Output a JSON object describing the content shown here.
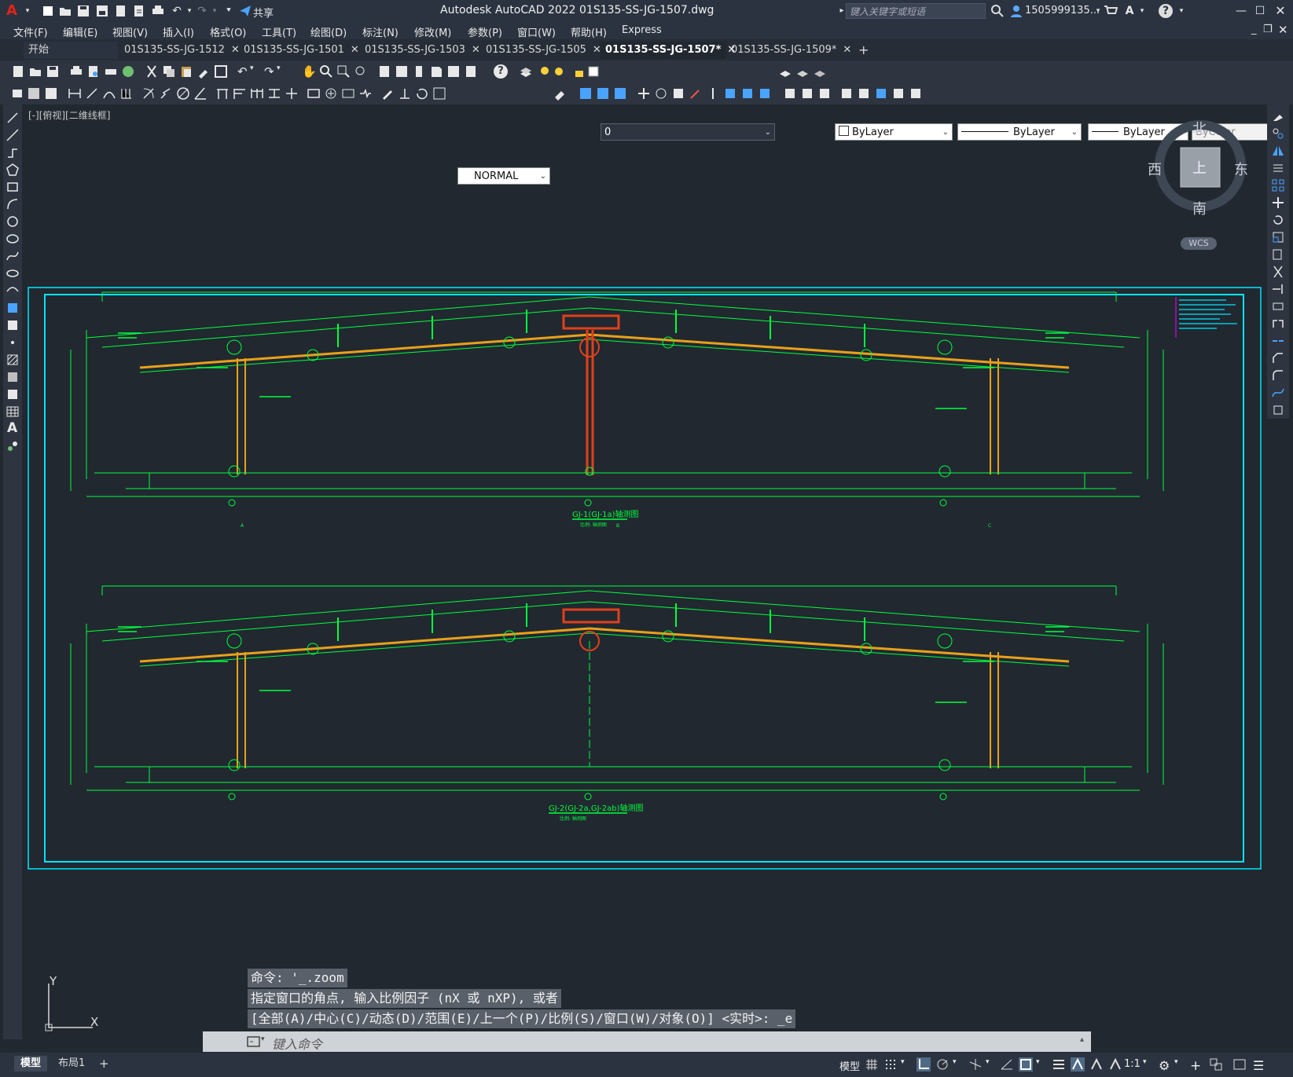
{
  "titlebar": {
    "app_title": "Autodesk AutoCAD 2022    01S135-SS-JG-1507.dwg",
    "share_label": "共享",
    "search_placeholder": "键入关键字或短语",
    "user": "1505999135...",
    "window_controls": [
      "minimize",
      "maximize",
      "close"
    ]
  },
  "menubar": {
    "items": [
      "文件(F)",
      "编辑(E)",
      "视图(V)",
      "插入(I)",
      "格式(O)",
      "工具(T)",
      "绘图(D)",
      "标注(N)",
      "修改(M)",
      "参数(P)",
      "窗口(W)",
      "帮助(H)",
      "Express"
    ]
  },
  "tabs": {
    "items": [
      {
        "label": "开始",
        "closable": false,
        "active": false
      },
      {
        "label": "01S135-SS-JG-1512",
        "closable": true,
        "active": false
      },
      {
        "label": "01S135-SS-JG-1501",
        "closable": true,
        "active": false
      },
      {
        "label": "01S135-SS-JG-1503",
        "closable": true,
        "active": false
      },
      {
        "label": "01S135-SS-JG-1505",
        "closable": true,
        "active": false
      },
      {
        "label": "01S135-SS-JG-1507*",
        "closable": true,
        "active": true
      },
      {
        "label": "01S135-SS-JG-1509*",
        "closable": true,
        "active": false
      }
    ],
    "add_label": "+"
  },
  "properties": {
    "layer": "0",
    "color": "ByLayer",
    "linetype": "ByLayer",
    "lineweight": "ByLayer",
    "plotstyle": "ByColor",
    "textstyle": "NORMAL"
  },
  "viewport": {
    "label": "[-][俯视][二维线框]",
    "viewcube": {
      "north": "北",
      "south": "南",
      "east": "东",
      "west": "西",
      "top": "上"
    },
    "wcs": "WCS"
  },
  "drawing": {
    "frame1_title": "GJ-1(GJ-1a)轴测图",
    "frame1_subtitle": "比例: 轴测图",
    "frame2_title": "GJ-2(GJ-2a,GJ-2ab)轴测图",
    "frame2_subtitle": "比例: 轴测图",
    "axis_labels": [
      "A",
      "B",
      "C"
    ],
    "ucs_x": "X",
    "ucs_y": "Y"
  },
  "command": {
    "history": [
      "命令: '_.zoom",
      "指定窗口的角点, 输入比例因子 (nX 或 nXP), 或者",
      "[全部(A)/中心(C)/动态(D)/范围(E)/上一个(P)/比例(S)/窗口(W)/对象(O)] <实时>: _e"
    ],
    "placeholder": "键入命令"
  },
  "statusbar": {
    "layout_tabs": [
      {
        "label": "模型",
        "active": true
      },
      {
        "label": "布局1",
        "active": false
      }
    ],
    "add_label": "+",
    "model_label": "模型",
    "scale": "1:1"
  },
  "colors": {
    "background": "#212830",
    "drawing_green": "#00ff3c",
    "frame_cyan": "#00e5ff",
    "beam_orange": "#e8a11a",
    "column_red": "#e0401a"
  }
}
